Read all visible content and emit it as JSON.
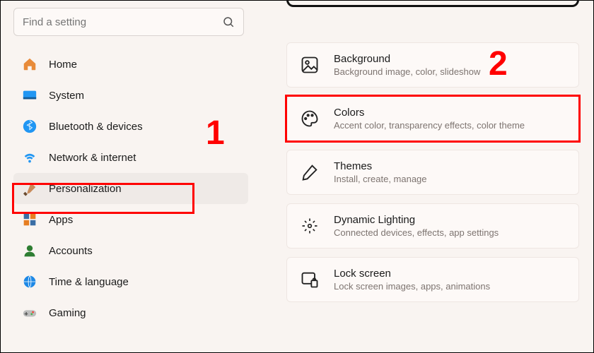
{
  "search": {
    "placeholder": "Find a setting"
  },
  "sidebar": {
    "items": [
      {
        "label": "Home"
      },
      {
        "label": "System"
      },
      {
        "label": "Bluetooth & devices"
      },
      {
        "label": "Network & internet"
      },
      {
        "label": "Personalization"
      },
      {
        "label": "Apps"
      },
      {
        "label": "Accounts"
      },
      {
        "label": "Time & language"
      },
      {
        "label": "Gaming"
      }
    ],
    "selected_index": 4
  },
  "main": {
    "cards": [
      {
        "title": "Background",
        "subtitle": "Background image, color, slideshow"
      },
      {
        "title": "Colors",
        "subtitle": "Accent color, transparency effects, color theme"
      },
      {
        "title": "Themes",
        "subtitle": "Install, create, manage"
      },
      {
        "title": "Dynamic Lighting",
        "subtitle": "Connected devices, effects, app settings"
      },
      {
        "title": "Lock screen",
        "subtitle": "Lock screen images, apps, animations"
      }
    ]
  },
  "annotations": {
    "one": "1",
    "two": "2"
  },
  "colors": {
    "red": "#ff0000",
    "bg": "#f9f4f1",
    "card": "#fdf9f7"
  }
}
